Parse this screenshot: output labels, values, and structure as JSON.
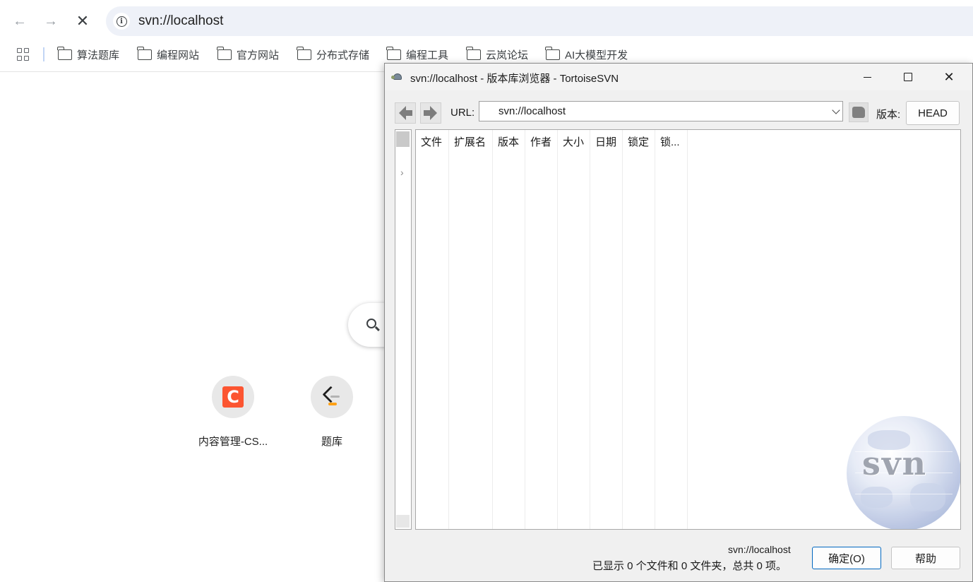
{
  "browser": {
    "address": "svn://localhost",
    "bookmarks": [
      "算法题库",
      "编程网站",
      "官方网站",
      "分布式存储",
      "编程工具",
      "云岚论坛",
      "AI大模型开发"
    ]
  },
  "new_tab": {
    "shortcuts": [
      {
        "label": "内容管理-CS...",
        "icon": "csdn-icon",
        "glyph": "C"
      },
      {
        "label": "题库",
        "icon": "leetcode-icon"
      }
    ]
  },
  "svn_dialog": {
    "title": "svn://localhost - 版本库浏览器 - TortoiseSVN",
    "url_label": "URL:",
    "url_value": "svn://localhost",
    "revision_label": "版本:",
    "revision_button": "HEAD",
    "columns": [
      "文件",
      "扩展名",
      "版本",
      "作者",
      "大小",
      "日期",
      "锁定",
      "锁..."
    ],
    "logo_text": "svn",
    "status_url": "svn://localhost",
    "status_text": "已显示 0 个文件和 0 文件夹，总共 0 项。",
    "ok_label": "确定(O)",
    "help_label": "帮助",
    "accent_color": "#0067c0"
  }
}
